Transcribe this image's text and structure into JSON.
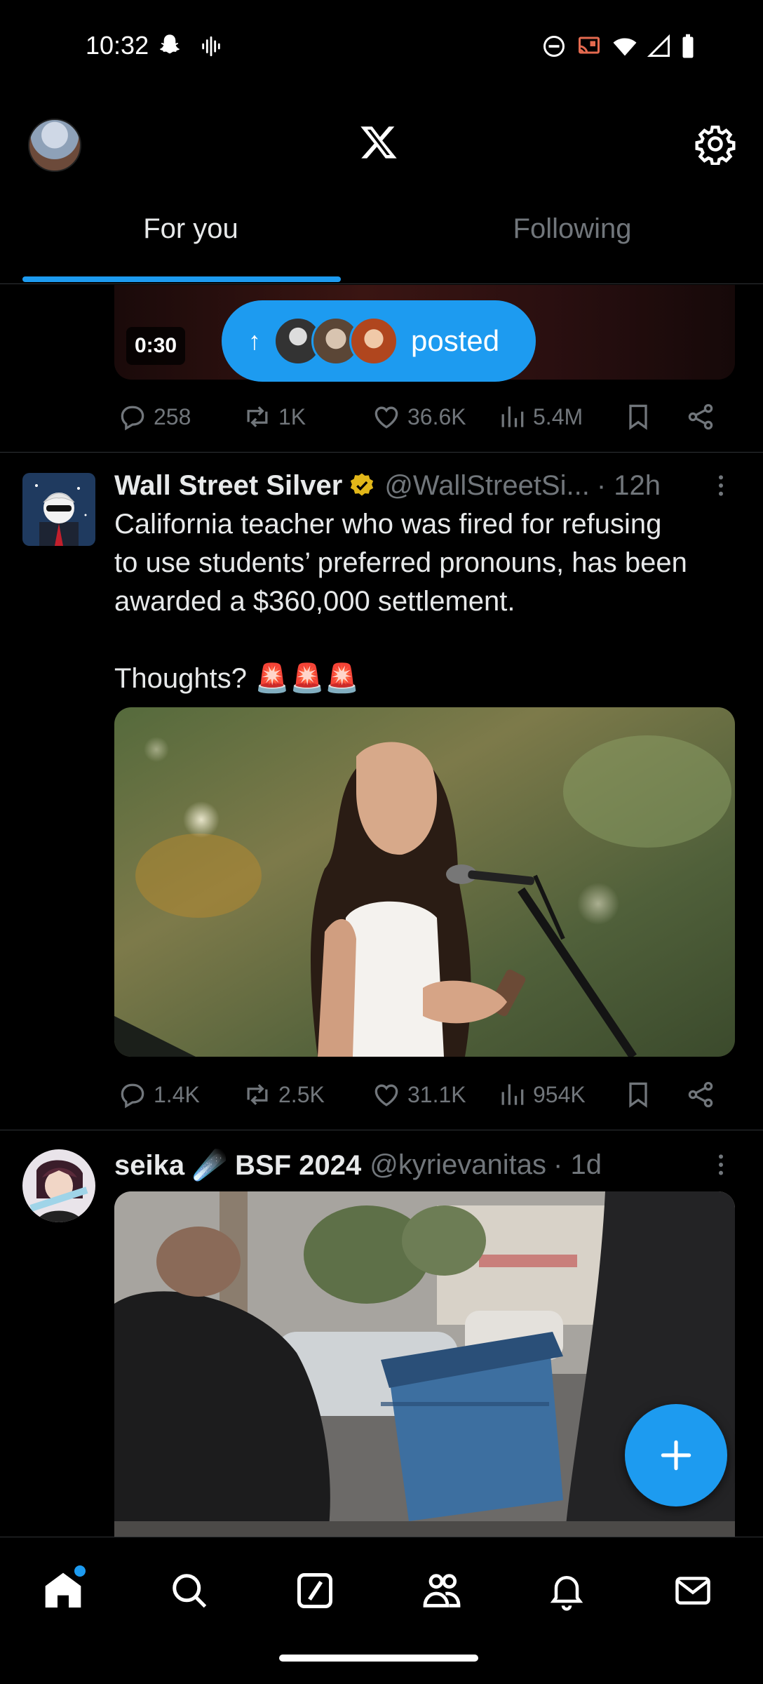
{
  "status_bar": {
    "time": "10:32",
    "left_icons": [
      "snapchat-icon",
      "voice-icon"
    ],
    "right_icons": [
      "dnd-icon",
      "cast-icon",
      "wifi-icon",
      "signal-icon",
      "battery-icon"
    ]
  },
  "header": {
    "logo": "X",
    "settings_icon": "gear-icon"
  },
  "tabs": [
    {
      "label": "For you",
      "active": true
    },
    {
      "label": "Following",
      "active": false
    }
  ],
  "feed": {
    "previous_post": {
      "video_duration": "0:30",
      "new_posts_pill": {
        "label": "posted",
        "arrow": "↑"
      },
      "actions": {
        "replies": "258",
        "reposts": "1K",
        "likes": "36.6K",
        "views": "5.4M"
      }
    },
    "tweets": [
      {
        "display_name": "Wall Street Silver",
        "verified": true,
        "handle": "@WallStreetSi...",
        "time": "· 12h",
        "text_lines": [
          "California teacher who was fired for refusing",
          "to use students’ preferred pronouns, has been",
          "awarded a $360,000 settlement."
        ],
        "text_thoughts": "Thoughts? 🚨🚨🚨",
        "actions": {
          "replies": "1.4K",
          "reposts": "2.5K",
          "likes": "31.1K",
          "views": "954K"
        }
      },
      {
        "display_name": "seika ☄️ BSF 2024",
        "handle": "@kyrievanitas",
        "time": "· 1d"
      }
    ]
  },
  "fab": {
    "icon": "plus-icon"
  },
  "bottom_nav": [
    "home-icon",
    "search-icon",
    "grok-icon",
    "communities-icon",
    "notifications-icon",
    "messages-icon"
  ],
  "colors": {
    "accent": "#1d9bf0",
    "background": "#000000",
    "muted": "#71767b",
    "text": "#e7e9ea",
    "divider": "#2f3336"
  }
}
